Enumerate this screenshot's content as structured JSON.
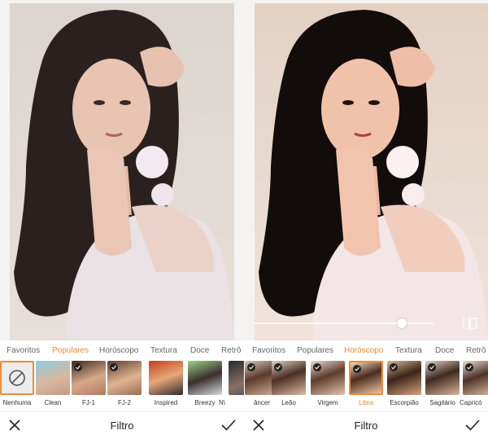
{
  "left_panel": {
    "tabs": [
      {
        "label": "Favoritos",
        "active": false
      },
      {
        "label": "Populares",
        "active": true
      },
      {
        "label": "Horóscopo",
        "active": false
      },
      {
        "label": "Textura",
        "active": false
      },
      {
        "label": "Doce",
        "active": false
      },
      {
        "label": "Retrô",
        "active": false
      }
    ],
    "thumbnails": [
      {
        "label": "Nenhuma",
        "selected": true,
        "checked": false,
        "icon": "none-icon"
      },
      {
        "label": "Clean",
        "selected": false,
        "checked": false
      },
      {
        "label": "FJ-1",
        "selected": false,
        "checked": true
      },
      {
        "label": "FJ-2",
        "selected": false,
        "checked": true
      },
      {
        "label": "Inspired",
        "selected": false,
        "checked": false
      },
      {
        "label": "Breezy",
        "selected": false,
        "checked": false
      },
      {
        "label": "N\\",
        "selected": false,
        "checked": false
      }
    ],
    "bottom_bar": {
      "title": "Filtro",
      "cancel_icon": "close-icon",
      "confirm_icon": "check-icon"
    }
  },
  "right_panel": {
    "tabs": [
      {
        "label": "Favoritos",
        "active": false
      },
      {
        "label": "Populares",
        "active": false
      },
      {
        "label": "Horóscopo",
        "active": true
      },
      {
        "label": "Textura",
        "active": false
      },
      {
        "label": "Doce",
        "active": false
      },
      {
        "label": "Retrô",
        "active": false
      }
    ],
    "thumbnails": [
      {
        "label": "âncer",
        "selected": false,
        "checked": true
      },
      {
        "label": "Leão",
        "selected": false,
        "checked": true
      },
      {
        "label": "Virgem",
        "selected": false,
        "checked": true,
        "heart": true
      },
      {
        "label": "Libra",
        "selected": true,
        "checked": true
      },
      {
        "label": "Escorpião",
        "selected": false,
        "checked": true
      },
      {
        "label": "Sagitário",
        "selected": false,
        "checked": true
      },
      {
        "label": "Capricó",
        "selected": false,
        "checked": true
      }
    ],
    "slider": {
      "value": 0.84
    },
    "bottom_bar": {
      "title": "Filtro",
      "cancel_icon": "close-icon",
      "confirm_icon": "check-icon"
    }
  },
  "colors": {
    "accent": "#ec8c3a",
    "text": "#222222",
    "muted": "#666666"
  }
}
